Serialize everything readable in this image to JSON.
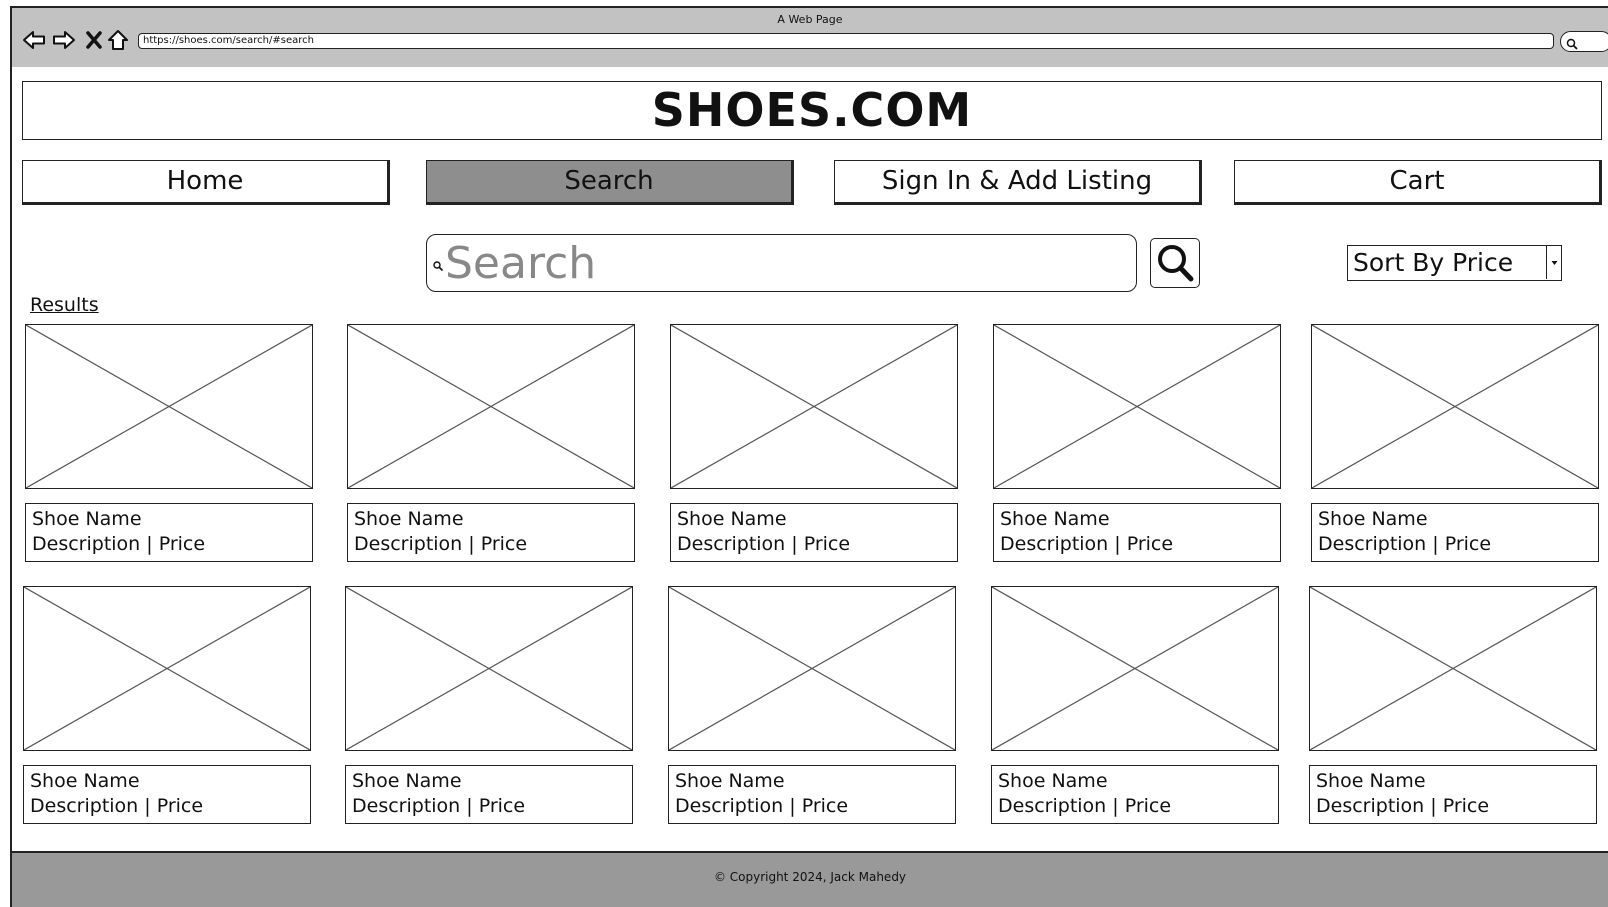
{
  "browser": {
    "window_title": "A Web Page",
    "url": "https://shoes.com/search/#search"
  },
  "header": {
    "site_title": "SHOES.COM"
  },
  "nav": {
    "items": [
      {
        "label": "Home"
      },
      {
        "label": "Search"
      },
      {
        "label": "Sign In & Add Listing"
      },
      {
        "label": "Cart"
      }
    ],
    "active": "Search"
  },
  "search": {
    "placeholder": "Search",
    "value": ""
  },
  "sort": {
    "selected": "Sort By Price"
  },
  "results": {
    "label": "Results",
    "items": [
      {
        "name": "Shoe Name",
        "details": "Description | Price"
      },
      {
        "name": "Shoe Name",
        "details": "Description | Price"
      },
      {
        "name": "Shoe Name",
        "details": "Description | Price"
      },
      {
        "name": "Shoe Name",
        "details": "Description | Price"
      },
      {
        "name": "Shoe Name",
        "details": "Description | Price"
      },
      {
        "name": "Shoe Name",
        "details": "Description | Price"
      },
      {
        "name": "Shoe Name",
        "details": "Description | Price"
      },
      {
        "name": "Shoe Name",
        "details": "Description | Price"
      },
      {
        "name": "Shoe Name",
        "details": "Description | Price"
      },
      {
        "name": "Shoe Name",
        "details": "Description | Price"
      }
    ]
  },
  "footer": {
    "copyright": "© Copyright 2024, Jack Mahedy"
  },
  "icons": {
    "back": "back-arrow-icon",
    "forward": "forward-arrow-icon",
    "close": "close-icon",
    "home": "home-icon",
    "search": "search-icon",
    "dropdown": "chevron-down-icon"
  },
  "colors": {
    "chrome": "#c2c2c2",
    "active_nav": "#8e8e8e",
    "footer": "#999999",
    "placeholder": "#888888"
  }
}
